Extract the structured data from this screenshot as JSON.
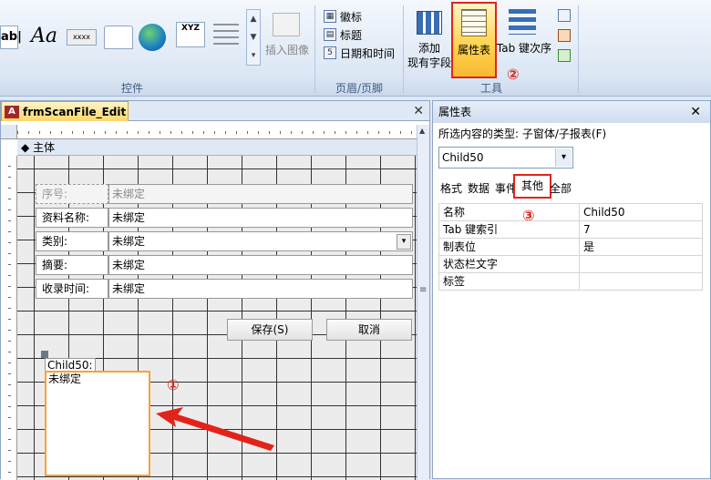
{
  "ribbon": {
    "controls_group_label": "控件",
    "header_footer_group_label": "页眉/页脚",
    "tools_group_label": "工具",
    "control_tiles": [
      "ab|",
      "Aa",
      "xxxx",
      "",
      "",
      "XYZ",
      ""
    ],
    "insert_image": "插入图像",
    "header_items": [
      "徽标",
      "标题",
      "日期和时间"
    ],
    "add_fields_label_1": "添加",
    "add_fields_label_2": "现有字段",
    "property_sheet_label": "属性表",
    "tab_order_label": "Tab 键次序",
    "callout_2": "②"
  },
  "designer": {
    "doc_tab_title": "frmScanFile_Edit",
    "section_label": "主体",
    "fields": [
      {
        "label": "序号:",
        "value": "未绑定",
        "disabled": true
      },
      {
        "label": "资料名称:",
        "value": "未绑定"
      },
      {
        "label": "类别:",
        "value": "未绑定"
      },
      {
        "label": "摘要:",
        "value": "未绑定"
      },
      {
        "label": "收录时间:",
        "value": "未绑定"
      }
    ],
    "save_button": "保存(S)",
    "cancel_button": "取消",
    "subform_label": "Child50:",
    "subform_value": "未绑定",
    "callout_1": "①"
  },
  "property_sheet": {
    "title": "属性表",
    "selection_type": "所选内容的类型: 子窗体/子报表(F)",
    "selected_object": "Child50",
    "tabs": [
      "格式",
      "数据",
      "事件",
      "其他",
      "全部"
    ],
    "active_tab": "其他",
    "callout_3": "③",
    "rows": [
      {
        "name": "名称",
        "value": "Child50"
      },
      {
        "name": "Tab 键索引",
        "value": "7"
      },
      {
        "name": "制表位",
        "value": "是"
      },
      {
        "name": "状态栏文字",
        "value": ""
      },
      {
        "name": "标签",
        "value": ""
      }
    ]
  },
  "colors": {
    "accent_red": "#e2231a",
    "selection_orange": "#f5a33a"
  }
}
